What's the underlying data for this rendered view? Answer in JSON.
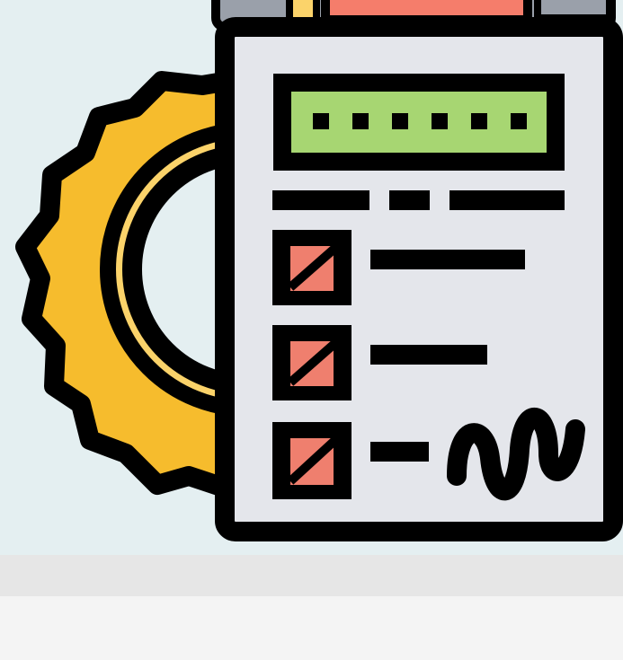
{
  "illustration": {
    "icon_name": "checklist-settings-icon",
    "parts": [
      "gear-icon",
      "clipboard-icon",
      "pencil-icon",
      "serial-display",
      "checkbox-icon",
      "signature-icon"
    ],
    "checklist_item_count": 3,
    "checked_items": 3,
    "colors": {
      "background": "#e4eff1",
      "gear": "#f6bc2d",
      "gear_inner_ring": "#fbd36a",
      "paper": "#e4e6eb",
      "display": "#a7d672",
      "checkbox_mark": "#ef7f6e",
      "pencil": "#f57d6b",
      "outline": "#000000",
      "footer_bar": "#e6e6e6",
      "footer_area": "#f4f4f4"
    }
  }
}
